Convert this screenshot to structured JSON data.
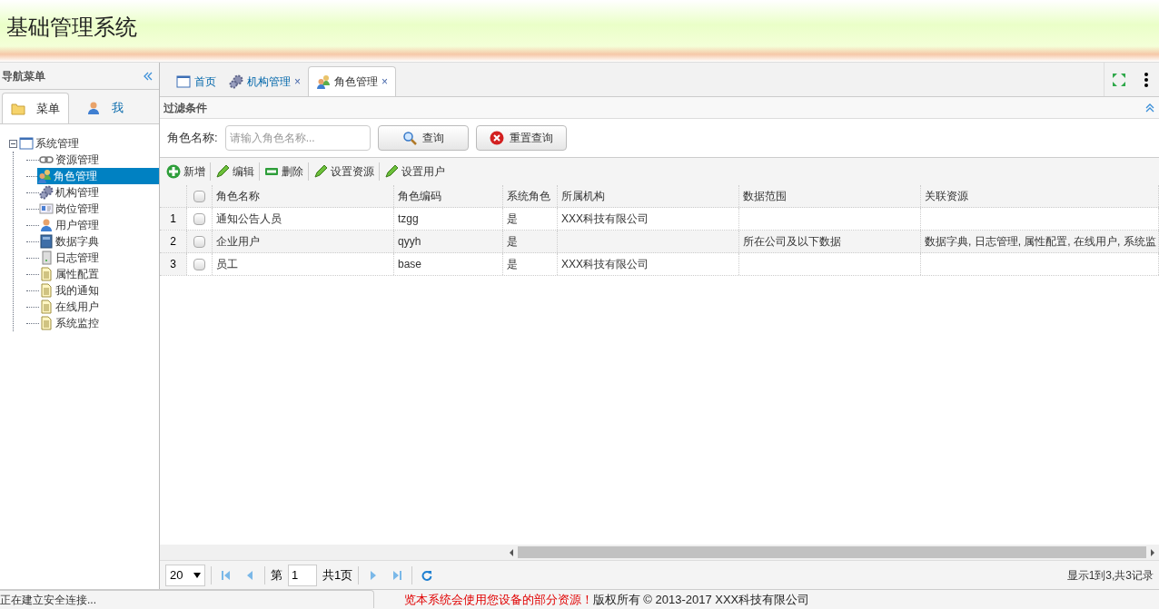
{
  "app_title": "基础管理系统",
  "nav": {
    "title": "导航菜单",
    "tabs": [
      {
        "label": "菜单",
        "kind": "folder",
        "selected": true
      },
      {
        "label": "我",
        "kind": "user",
        "selected": false
      }
    ],
    "tree": [
      {
        "label": "系统管理",
        "kind": "window",
        "expanded": true,
        "selected": false,
        "children": [
          {
            "label": "资源管理",
            "kind": "link",
            "selected": false
          },
          {
            "label": "角色管理",
            "kind": "users",
            "selected": true
          },
          {
            "label": "机构管理",
            "kind": "gears",
            "selected": false
          },
          {
            "label": "岗位管理",
            "kind": "card",
            "selected": false
          },
          {
            "label": "用户管理",
            "kind": "user",
            "selected": false
          },
          {
            "label": "数据字典",
            "kind": "book",
            "selected": false
          },
          {
            "label": "日志管理",
            "kind": "server",
            "selected": false
          },
          {
            "label": "属性配置",
            "kind": "doc",
            "selected": false
          },
          {
            "label": "我的通知",
            "kind": "doc",
            "selected": false
          },
          {
            "label": "在线用户",
            "kind": "doc",
            "selected": false
          },
          {
            "label": "系统监控",
            "kind": "doc",
            "selected": false
          }
        ]
      }
    ]
  },
  "tabs": [
    {
      "label": "首页",
      "kind": "window",
      "closable": false,
      "selected": false
    },
    {
      "label": "机构管理",
      "kind": "gears",
      "closable": true,
      "selected": false
    },
    {
      "label": "角色管理",
      "kind": "users",
      "closable": true,
      "selected": true
    }
  ],
  "tab_close": "×",
  "filter": {
    "title": "过滤条件",
    "label": "角色名称:",
    "placeholder": "请输入角色名称...",
    "buttons": [
      {
        "label": "查询",
        "kind": "search"
      },
      {
        "label": "重置查询",
        "kind": "reset"
      }
    ]
  },
  "toolbar": [
    {
      "label": "新增",
      "kind": "add"
    },
    {
      "label": "编辑",
      "kind": "edit"
    },
    {
      "label": "删除",
      "kind": "delete"
    },
    {
      "label": "设置资源",
      "kind": "edit"
    },
    {
      "label": "设置用户",
      "kind": "edit"
    }
  ],
  "table": {
    "all_checked": false,
    "columns": [
      "角色名称",
      "角色编码",
      "系统角色",
      "所属机构",
      "数据范围",
      "关联资源"
    ],
    "rows": [
      {
        "num": "1",
        "checked": false,
        "cells": [
          "通知公告人员",
          "tzgg",
          "是",
          "XXX科技有限公司",
          "",
          ""
        ]
      },
      {
        "num": "2",
        "checked": false,
        "cells": [
          "企业用户",
          "qyyh",
          "是",
          "",
          "所在公司及以下数据",
          "数据字典, 日志管理, 属性配置, 在线用户, 系统监"
        ]
      },
      {
        "num": "3",
        "checked": false,
        "cells": [
          "员工",
          "base",
          "是",
          "XXX科技有限公司",
          "",
          ""
        ]
      }
    ]
  },
  "pager": {
    "page_size": "20",
    "page_label": "第",
    "page": "1",
    "total_pages": "共1页",
    "summary": "显示1到3,共3记录"
  },
  "status": {
    "loading": "正在建立安全连接...",
    "notice": "览本系统会使用您设备的部分资源！",
    "copyright": "版权所有 © 2013-2017 XXX科技有限公司"
  }
}
